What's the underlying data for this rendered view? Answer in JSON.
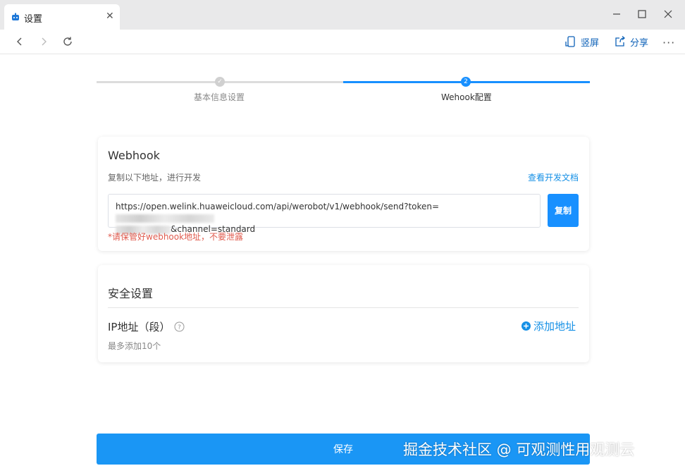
{
  "window": {
    "tab_title": "设置",
    "tab_close": "✕",
    "tab_icon": "app-logo-icon"
  },
  "toolbar": {
    "portrait_label": "竖屏",
    "share_label": "分享",
    "more_label": "···"
  },
  "steps": {
    "step1": {
      "label": "基本信息设置",
      "marker": "✓"
    },
    "step2": {
      "label": "Wehook配置",
      "marker": "2"
    }
  },
  "webhook": {
    "title": "Webhook",
    "hint": "复制以下地址，进行开发",
    "docs_link": "查看开发文档",
    "url_line1": "https://open.welink.huaweicloud.com/api/werobot/v1/webhook/send?token=",
    "url_line2": "&channel=standard",
    "copy_label": "复制",
    "warning": "*请保管好webhook地址，不要泄露"
  },
  "security": {
    "title": "安全设置",
    "ip_label": "IP地址（段）",
    "add_label": "添加地址",
    "limit_text": "最多添加10个"
  },
  "footer": {
    "save_label": "保存",
    "watermark": "掘金技术社区 @ 可观测性用观测云"
  },
  "colors": {
    "accent": "#1890ff",
    "link": "#1590e6",
    "warning": "#e05b4e",
    "step_done": "#d0d0d0"
  }
}
